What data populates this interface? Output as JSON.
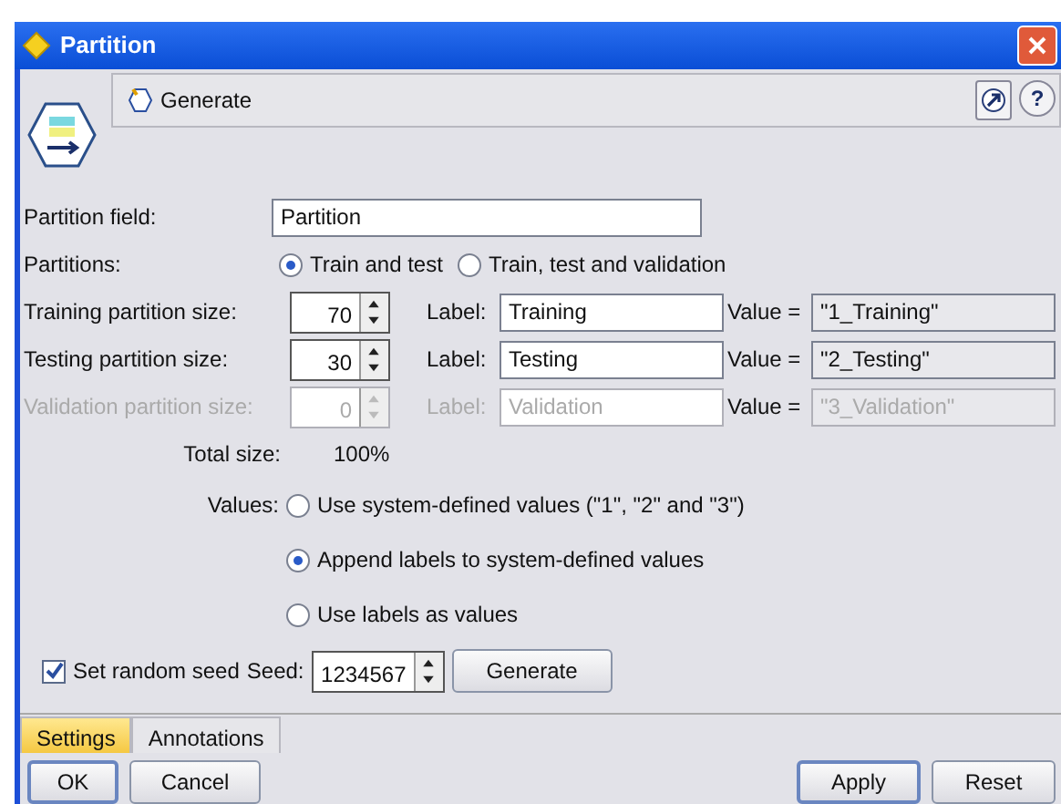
{
  "window": {
    "title": "Partition"
  },
  "toolbar": {
    "generate_menu": "Generate",
    "help": "?"
  },
  "partition_field": {
    "label": "Partition field:",
    "value": "Partition"
  },
  "partitions": {
    "label": "Partitions:",
    "options": [
      {
        "label": "Train and test",
        "selected": true
      },
      {
        "label": "Train, test and validation",
        "selected": false
      }
    ]
  },
  "sizes": [
    {
      "label": "Training partition size:",
      "value": "70",
      "disabled": false,
      "label_caption": "Label:",
      "label_value": "Training",
      "value_caption": "Value =",
      "value_text": "\"1_Training\""
    },
    {
      "label": "Testing partition size:",
      "value": "30",
      "disabled": false,
      "label_caption": "Label:",
      "label_value": "Testing",
      "value_caption": "Value =",
      "value_text": "\"2_Testing\""
    },
    {
      "label": "Validation partition size:",
      "value": "0",
      "disabled": true,
      "label_caption": "Label:",
      "label_value": "Validation",
      "value_caption": "Value =",
      "value_text": "\"3_Validation\""
    }
  ],
  "total": {
    "label": "Total size:",
    "value": "100%"
  },
  "values": {
    "label": "Values:",
    "options": [
      {
        "label": "Use system-defined values (\"1\", \"2\" and \"3\")",
        "selected": false
      },
      {
        "label": "Append labels to system-defined values",
        "selected": true
      },
      {
        "label": "Use labels as values",
        "selected": false
      }
    ]
  },
  "seed": {
    "label": "Set random seed",
    "checked": true,
    "seed_label": "Seed:",
    "value": "1234567",
    "button": "Generate"
  },
  "tabs": [
    {
      "label": "Settings",
      "selected": true
    },
    {
      "label": "Annotations",
      "selected": false
    }
  ],
  "buttons_left": [
    "OK",
    "Cancel"
  ],
  "buttons_right": [
    "Apply",
    "Reset"
  ]
}
